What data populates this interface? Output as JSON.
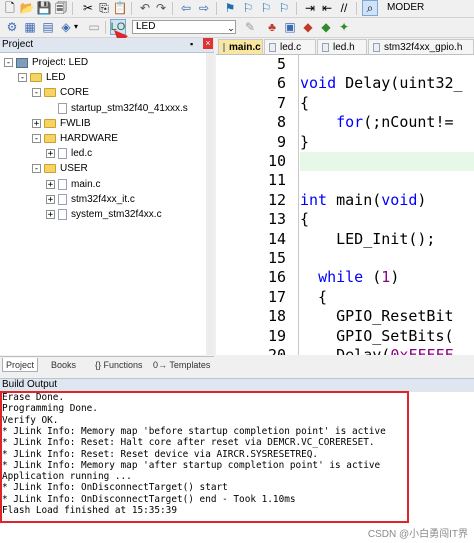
{
  "toolbar": {
    "moder_label": "MODER",
    "target_select_value": "LED"
  },
  "project": {
    "header_title": "Project",
    "tree": [
      {
        "label": "Project: LED",
        "depth": 0,
        "kind": "project",
        "expander": "-"
      },
      {
        "label": "LED",
        "depth": 1,
        "kind": "folder",
        "expander": "-"
      },
      {
        "label": "CORE",
        "depth": 2,
        "kind": "folder",
        "expander": "-"
      },
      {
        "label": "startup_stm32f40_41xxx.s",
        "depth": 3,
        "kind": "file",
        "expander": ""
      },
      {
        "label": "FWLIB",
        "depth": 2,
        "kind": "folder",
        "expander": "+"
      },
      {
        "label": "HARDWARE",
        "depth": 2,
        "kind": "folder",
        "expander": "-"
      },
      {
        "label": "led.c",
        "depth": 3,
        "kind": "file",
        "expander": "+"
      },
      {
        "label": "USER",
        "depth": 2,
        "kind": "folder",
        "expander": "-"
      },
      {
        "label": "main.c",
        "depth": 3,
        "kind": "file",
        "expander": "+"
      },
      {
        "label": "stm32f4xx_it.c",
        "depth": 3,
        "kind": "file",
        "expander": "+"
      },
      {
        "label": "system_stm32f4xx.c",
        "depth": 3,
        "kind": "file",
        "expander": "+"
      }
    ],
    "bottom_tabs": [
      "Project",
      "Books",
      "{} Functions",
      "0→ Templates"
    ]
  },
  "editor": {
    "tabs": [
      {
        "label": "main.c",
        "active": true
      },
      {
        "label": "led.c",
        "active": false
      },
      {
        "label": "led.h",
        "active": false
      },
      {
        "label": "stm32f4xx_gpio.h",
        "active": false
      }
    ],
    "lines": [
      {
        "n": "5",
        "code": ""
      },
      {
        "n": "6",
        "code": "void Delay(uint32_"
      },
      {
        "n": "7",
        "code": "{"
      },
      {
        "n": "8",
        "code": "    for(;nCount!="
      },
      {
        "n": "9",
        "code": "}"
      },
      {
        "n": "10",
        "code": ""
      },
      {
        "n": "11",
        "code": ""
      },
      {
        "n": "12",
        "code": "int main(void)"
      },
      {
        "n": "13",
        "code": "{"
      },
      {
        "n": "14",
        "code": "    LED_Init();"
      },
      {
        "n": "15",
        "code": ""
      },
      {
        "n": "16",
        "code": "  while (1)"
      },
      {
        "n": "17",
        "code": "  {"
      },
      {
        "n": "18",
        "code": "    GPIO_ResetBit"
      },
      {
        "n": "19",
        "code": "    GPIO_SetBits("
      },
      {
        "n": "20",
        "code": "    Delay(0xFFFFF"
      }
    ]
  },
  "build": {
    "header_title": "Build Output",
    "lines": [
      "Erase Done.",
      "Programming Done.",
      "Verify OK.",
      "* JLink Info: Memory map 'before startup completion point' is active",
      "* JLink Info: Reset: Halt core after reset via DEMCR.VC_CORERESET.",
      "* JLink Info: Reset: Reset device via AIRCR.SYSRESETREQ.",
      "* JLink Info: Memory map 'after startup completion point' is active",
      "Application running ...",
      "* JLink Info: OnDisconnectTarget() start",
      "* JLink Info: OnDisconnectTarget() end - Took 1.10ms",
      "Flash Load finished at 15:35:39"
    ]
  },
  "watermark": "CSDN @小白勇闯IT界",
  "colors": {
    "annotation_red": "#e0252a",
    "keyword_blue": "#0000ff",
    "number_purple": "#8b008b"
  }
}
